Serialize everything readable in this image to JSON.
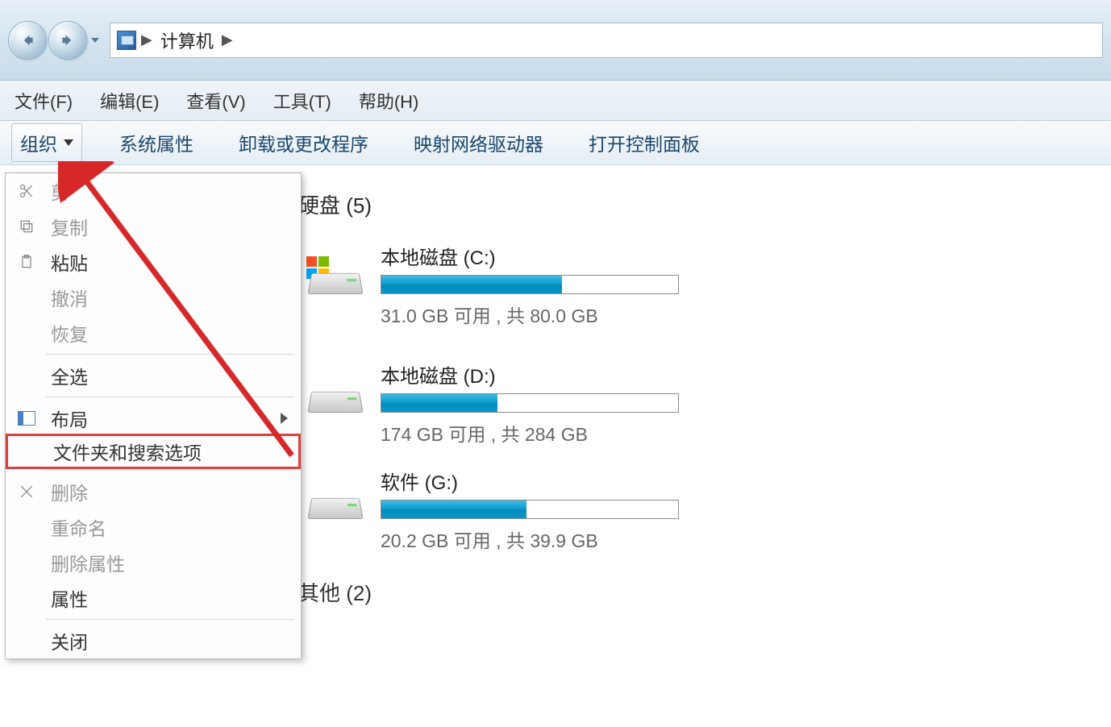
{
  "breadcrumb": {
    "location": "计算机"
  },
  "menubar": {
    "file": "文件(F)",
    "edit": "编辑(E)",
    "view": "查看(V)",
    "tools": "工具(T)",
    "help": "帮助(H)"
  },
  "toolbar": {
    "organize": "组织",
    "system_properties": "系统属性",
    "uninstall_change": "卸载或更改程序",
    "map_network_drive": "映射网络驱动器",
    "open_control_panel": "打开控制面板"
  },
  "context_menu": {
    "cut": "剪",
    "copy": "复制",
    "paste": "粘贴",
    "undo": "撤消",
    "redo": "恢复",
    "select_all": "全选",
    "layout": "布局",
    "folder_search_options": "文件夹和搜索选项",
    "delete": "删除",
    "rename": "重命名",
    "remove_properties": "删除属性",
    "properties": "属性",
    "close": "关闭"
  },
  "sections": {
    "hdd_label": "硬盘 (5)",
    "other_label": "其他 (2)"
  },
  "drives": {
    "c": {
      "name": "本地磁盘 (C:)",
      "free_text": "31.0 GB 可用 , 共 80.0 GB",
      "used_percent": 61
    },
    "d": {
      "name": "本地磁盘 (D:)",
      "free_text": "174 GB 可用 , 共 284 GB",
      "used_percent": 39
    },
    "g": {
      "name": "软件 (G:)",
      "free_text": "20.2 GB 可用 , 共 39.9 GB",
      "used_percent": 49
    }
  }
}
